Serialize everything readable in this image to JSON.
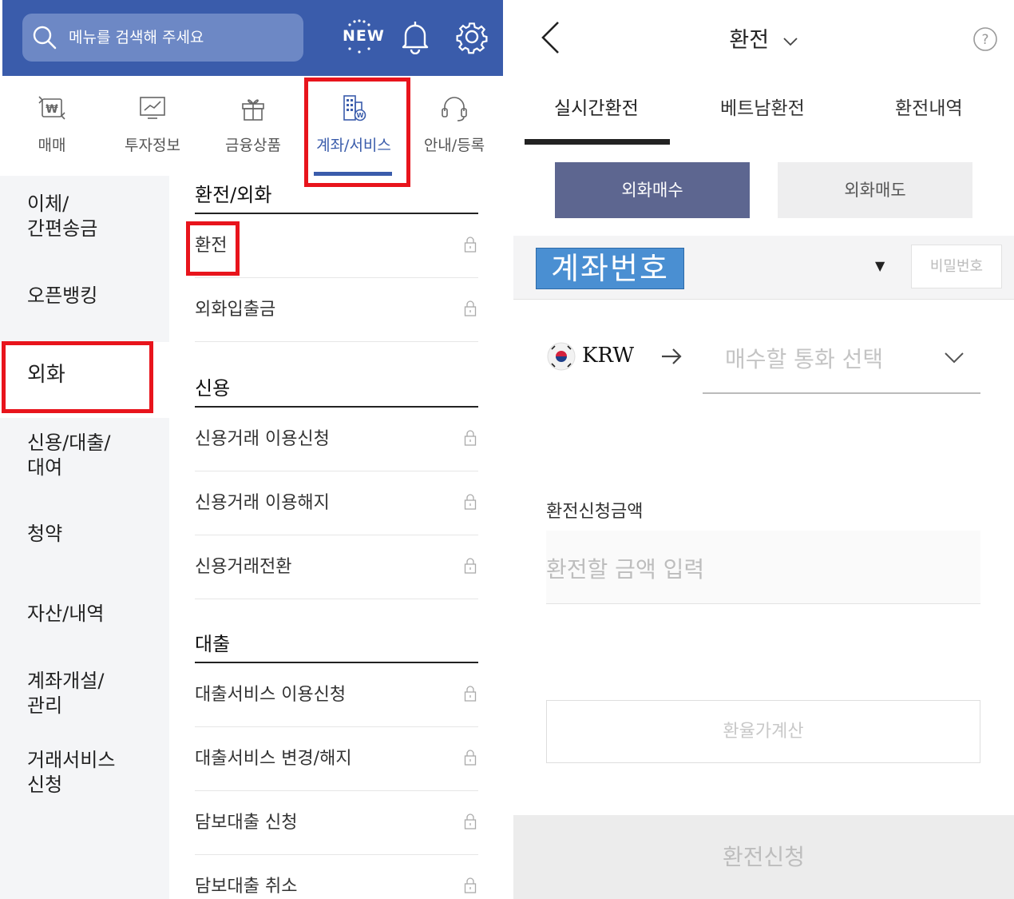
{
  "left": {
    "search": {
      "placeholder": "메뉴를 검색해 주세요"
    },
    "new_badge": "NEW",
    "categories": [
      {
        "label": "매매",
        "icon": "trade-won-icon"
      },
      {
        "label": "투자정보",
        "icon": "chart-icon"
      },
      {
        "label": "금융상품",
        "icon": "gift-icon"
      },
      {
        "label": "계좌/서비스",
        "icon": "building-icon",
        "active": true
      },
      {
        "label": "안내/등록",
        "icon": "headset-icon"
      }
    ],
    "side_menu": [
      {
        "label": "이체/\n간편송금"
      },
      {
        "label": "오픈뱅킹"
      },
      {
        "label": "외화",
        "active": true
      },
      {
        "label": "신용/대출/\n대여"
      },
      {
        "label": "청약"
      },
      {
        "label": "자산/내역"
      },
      {
        "label": "계좌개설/\n관리"
      },
      {
        "label": "거래서비스\n신청"
      }
    ],
    "sections": [
      {
        "title": "환전/외화",
        "items": [
          "환전",
          "외화입출금"
        ]
      },
      {
        "title": "신용",
        "items": [
          "신용거래 이용신청",
          "신용거래 이용해지",
          "신용거래전환"
        ]
      },
      {
        "title": "대출",
        "items": [
          "대출서비스 이용신청",
          "대출서비스 변경/해지",
          "담보대출 신청",
          "담보대출 취소"
        ]
      }
    ]
  },
  "right": {
    "title": "환전",
    "tabs": [
      "실시간환전",
      "베트남환전",
      "환전내역"
    ],
    "segments": {
      "buy": "외화매수",
      "sell": "외화매도"
    },
    "account_label": "계좌번호",
    "password_placeholder": "비밀번호",
    "from_currency": "KRW",
    "to_currency_placeholder": "매수할 통화 선택",
    "amount_label": "환전신청금액",
    "amount_placeholder": "환전할 금액 입력",
    "calc_button": "환율가계산",
    "submit_button": "환전신청"
  },
  "colors": {
    "header_blue": "#3a5cab",
    "highlight_red": "#e8141c",
    "segment_active": "#5d6690",
    "account_label_bg": "#4a8fd2"
  }
}
